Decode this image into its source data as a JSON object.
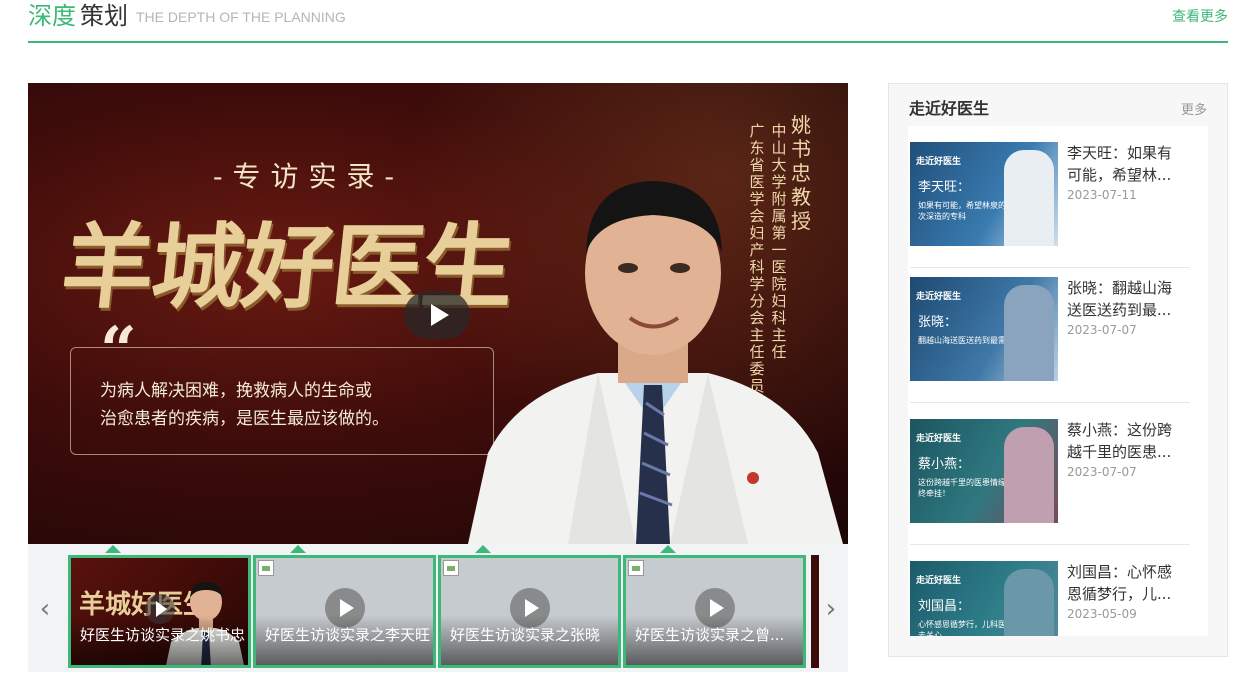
{
  "header": {
    "title_green": "深度",
    "title_dark": "策划",
    "title_en": "THE DEPTH OF THE PLANNING",
    "more": "查看更多"
  },
  "player": {
    "sub_title": "-专访实录-",
    "big_title": "羊城好医生",
    "quote_mark": "“",
    "quote_line1": "为病人解决困难，挽救病人的生命或",
    "quote_line2": "治愈患者的疾病，是医生最应该做的。",
    "vertical_1": "广东省医学会妇产科学分会主任委员",
    "vertical_2": "中山大学附属第一医院妇科主任",
    "vertical_3": "姚书忠教授"
  },
  "strip": {
    "prev": "‹",
    "next": "›",
    "thumbs": [
      {
        "label": "好医生访谈实录之姚书忠",
        "mini": "羊城好医生"
      },
      {
        "label": "好医生访谈实录之李天旺"
      },
      {
        "label": "好医生访谈实录之张晓"
      },
      {
        "label": "好医生访谈实录之曾..."
      }
    ]
  },
  "sidebar": {
    "title": "走近好医生",
    "more": "更多",
    "items": [
      {
        "line1": "李天旺：如果有",
        "line2": "可能，希望林...",
        "date": "2023-07-11",
        "img_label": "走近好医生",
        "img_name": "李天旺：",
        "img_cap": "如果有可能，希望林泉的后代是五次深造的专科",
        "bg": "#2d5f8a"
      },
      {
        "line1": "张晓：翻越山海",
        "line2": "送医送药到最...",
        "date": "2023-07-07",
        "img_label": "走近好医生",
        "img_name": "张晓：",
        "img_cap": "翻越山海送医送药到最需要的地方",
        "bg": "#2f5f86"
      },
      {
        "line1": "蔡小燕：这份跨",
        "line2": "越千里的医患...",
        "date": "2023-07-07",
        "img_label": "走近好医生",
        "img_name": "蔡小燕：",
        "img_cap": "这份跨越千里的医患情缘，让我始终牵挂！",
        "bg": "#2a6a70"
      },
      {
        "line1": "刘国昌：心怀感",
        "line2": "恩循梦行，儿...",
        "date": "2023-05-09",
        "img_label": "走近好医生",
        "img_name": "刘国昌：",
        "img_cap": "心怀感恩循梦行，儿科医生要去爱去关心",
        "bg": "#2a6878"
      }
    ]
  },
  "colors": {
    "accent": "#3cb878",
    "muted": "#999999"
  }
}
